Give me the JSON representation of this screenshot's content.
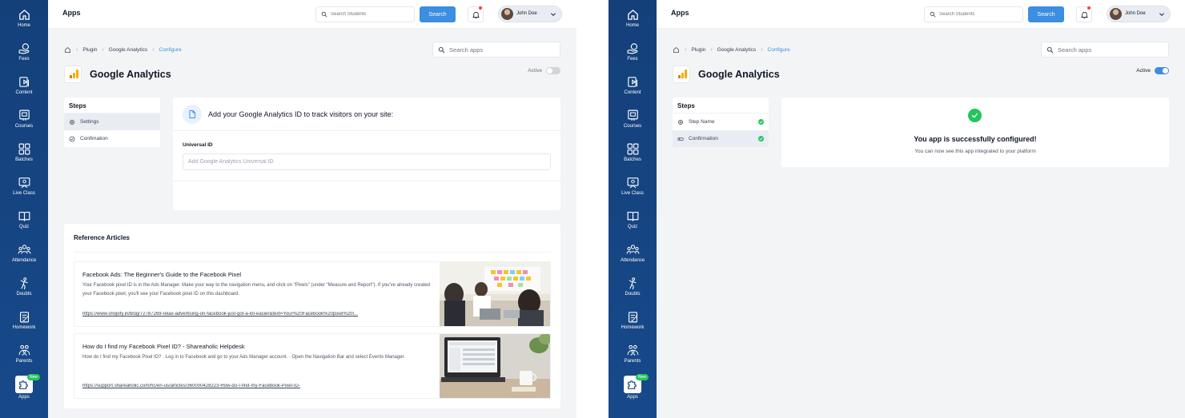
{
  "nav": {
    "items": [
      {
        "label": "Home",
        "icon": "home-icon"
      },
      {
        "label": "Fees",
        "icon": "fees-icon"
      },
      {
        "label": "Content",
        "icon": "content-icon"
      },
      {
        "label": "Courses",
        "icon": "courses-icon"
      },
      {
        "label": "Batches",
        "icon": "batches-icon"
      },
      {
        "label": "Live Class",
        "icon": "live-class-icon"
      },
      {
        "label": "Quiz",
        "icon": "quiz-icon"
      },
      {
        "label": "Attendance",
        "icon": "attendance-icon"
      },
      {
        "label": "Doubts",
        "icon": "doubts-icon"
      },
      {
        "label": "Homework",
        "icon": "homework-icon"
      },
      {
        "label": "Parents",
        "icon": "parents-icon"
      },
      {
        "label": "Apps",
        "icon": "apps-puzzle-icon",
        "badge": "New",
        "active": true
      }
    ]
  },
  "topbar": {
    "title": "Apps",
    "search_placeholder": "Search Students",
    "search_button": "Search",
    "user_name": "John Doe",
    "notification_dot_color": "#ef4444"
  },
  "breadcrumb": {
    "items": [
      "Plugin",
      "Google Analytics",
      "Configure"
    ]
  },
  "search_apps": {
    "placeholder": "Search apps"
  },
  "app": {
    "name": "Google Analytics",
    "status_label": "Active"
  },
  "colors": {
    "accent": "#3b8ee0",
    "sidebar": "#17498a",
    "success": "#22c55e"
  },
  "screen_a": {
    "toggle_on": false,
    "steps_title": "Steps",
    "steps": [
      {
        "label": "Settings",
        "selected": true
      },
      {
        "label": "Confimation",
        "selected": false
      }
    ],
    "card_heading": "Add your Google Analytics ID to track visitors on your site:",
    "field_label": "Universal ID",
    "field_placeholder": "Add Google Analytics Universal ID",
    "references_title": "Reference Articles",
    "articles": [
      {
        "title": "Facebook Ads: The Beginner's Guide to the Facebook Pixel",
        "description": "Your Facebook pixel ID is in the Ads Manager. Make your way to the navigation menu, and click on \"Pixels\" (under \"Measure and Report\"). If you've already created your Facebook pixel, you'll see your Facebook pixel ID on this dashboard.",
        "link": "https://www.shopify.in/blog/72787269-relax-advertising-on-facebook-just-got-a-lot-easier&text=Your%20Facebook%20pixel%20I..."
      },
      {
        "title": "How do I find my Facebook Pixel ID? - Shareaholic Helpdesk",
        "description": " How do I find my Facebook Pixel ID? · Log in to Facebook and go to your Ads Manager account. · Open the Navigation Bar and select Events Manager.",
        "link": "https://support.shareaholic.com/hc/en-us/articles/360000428223-How-do-I-find-my-Facebook-Pixel-ID-"
      }
    ]
  },
  "screen_b": {
    "toggle_on": true,
    "steps_title": "Steps",
    "steps": [
      {
        "label": "Step Name",
        "selected": false,
        "done": true
      },
      {
        "label": "Confirmation",
        "selected": true,
        "done": true
      }
    ],
    "success_title": "You app is successfully configured!",
    "success_subtitle": "You can now see this app integrated to your platform"
  }
}
